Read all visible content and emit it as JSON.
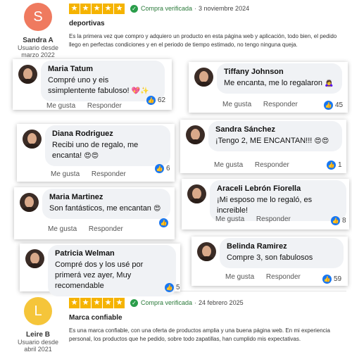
{
  "colors": {
    "star": "#f5b300",
    "verified": "#2a9d4a",
    "facebook_blue": "#1877f2",
    "avatar_s": "#ef7a5f",
    "avatar_l": "#f5c53a"
  },
  "reviews": [
    {
      "initial": "S",
      "name": "Sandra A",
      "since_label": "Usuario desde",
      "since_date": "marzo 2022",
      "rating": 5,
      "verified_label": "Compra verificada",
      "separator": "·",
      "date": "3 noviembre 2024",
      "title": "deportivas",
      "text": "Es la primera vez que compro y adquiero un producto en esta página web y aplicación, todo bien, el pedido llego en perfectas condiciones y en el periodo de tiempo estimado, no tengo ninguna queja."
    },
    {
      "initial": "L",
      "name": "Leire B",
      "since_label": "Usuario desde",
      "since_date": "abril 2021",
      "rating": 5,
      "verified_label": "Compra verificada",
      "separator": "·",
      "date": "24 febrero 2025",
      "title": "Marca confiable",
      "text": "Es una marca confiable, con una oferta de productos amplia y una buena página web. En mi experiencia personal, los productos que he pedido, sobre todo zapatillas, han cumplido mis expectativas."
    }
  ],
  "comment_actions": {
    "like": "Me gusta",
    "reply": "Responder"
  },
  "comments": [
    {
      "name": "Maria Tatum",
      "text": "Compré uno y eis ssimplentente fabuloso!",
      "emoji": "💖✨",
      "count": "62"
    },
    {
      "name": "Tiffany Johnson",
      "text": "Me encanta, me lo regalaron",
      "emoji": "🙇‍♀️",
      "count": "45"
    },
    {
      "name": "Diana Rodriguez",
      "text": "Recibi uno de regalo, me encanta!",
      "emoji": "😍😍",
      "count": "6"
    },
    {
      "name": "Sandra Sánchez",
      "text": "¡Tengo 2, ME ENCANTAN!!!",
      "emoji": "😍😍",
      "count": "1"
    },
    {
      "name": "Maria Martinez",
      "text": "Son fantásticos, me encantan",
      "emoji": "😍",
      "count": ""
    },
    {
      "name": "Araceli Lebrón Fiorella",
      "text": "¡Mi esposo me lo regaló, es increible!",
      "emoji": "",
      "count": "8"
    },
    {
      "name": "Patricia Welman",
      "text": "Compré dos y los usé por primerá vez ayer, Muy recomendable",
      "emoji": "",
      "count": "5"
    },
    {
      "name": "Belinda Ramirez",
      "text": "Compre 3, son fabulosos",
      "emoji": "",
      "count": "59"
    }
  ]
}
